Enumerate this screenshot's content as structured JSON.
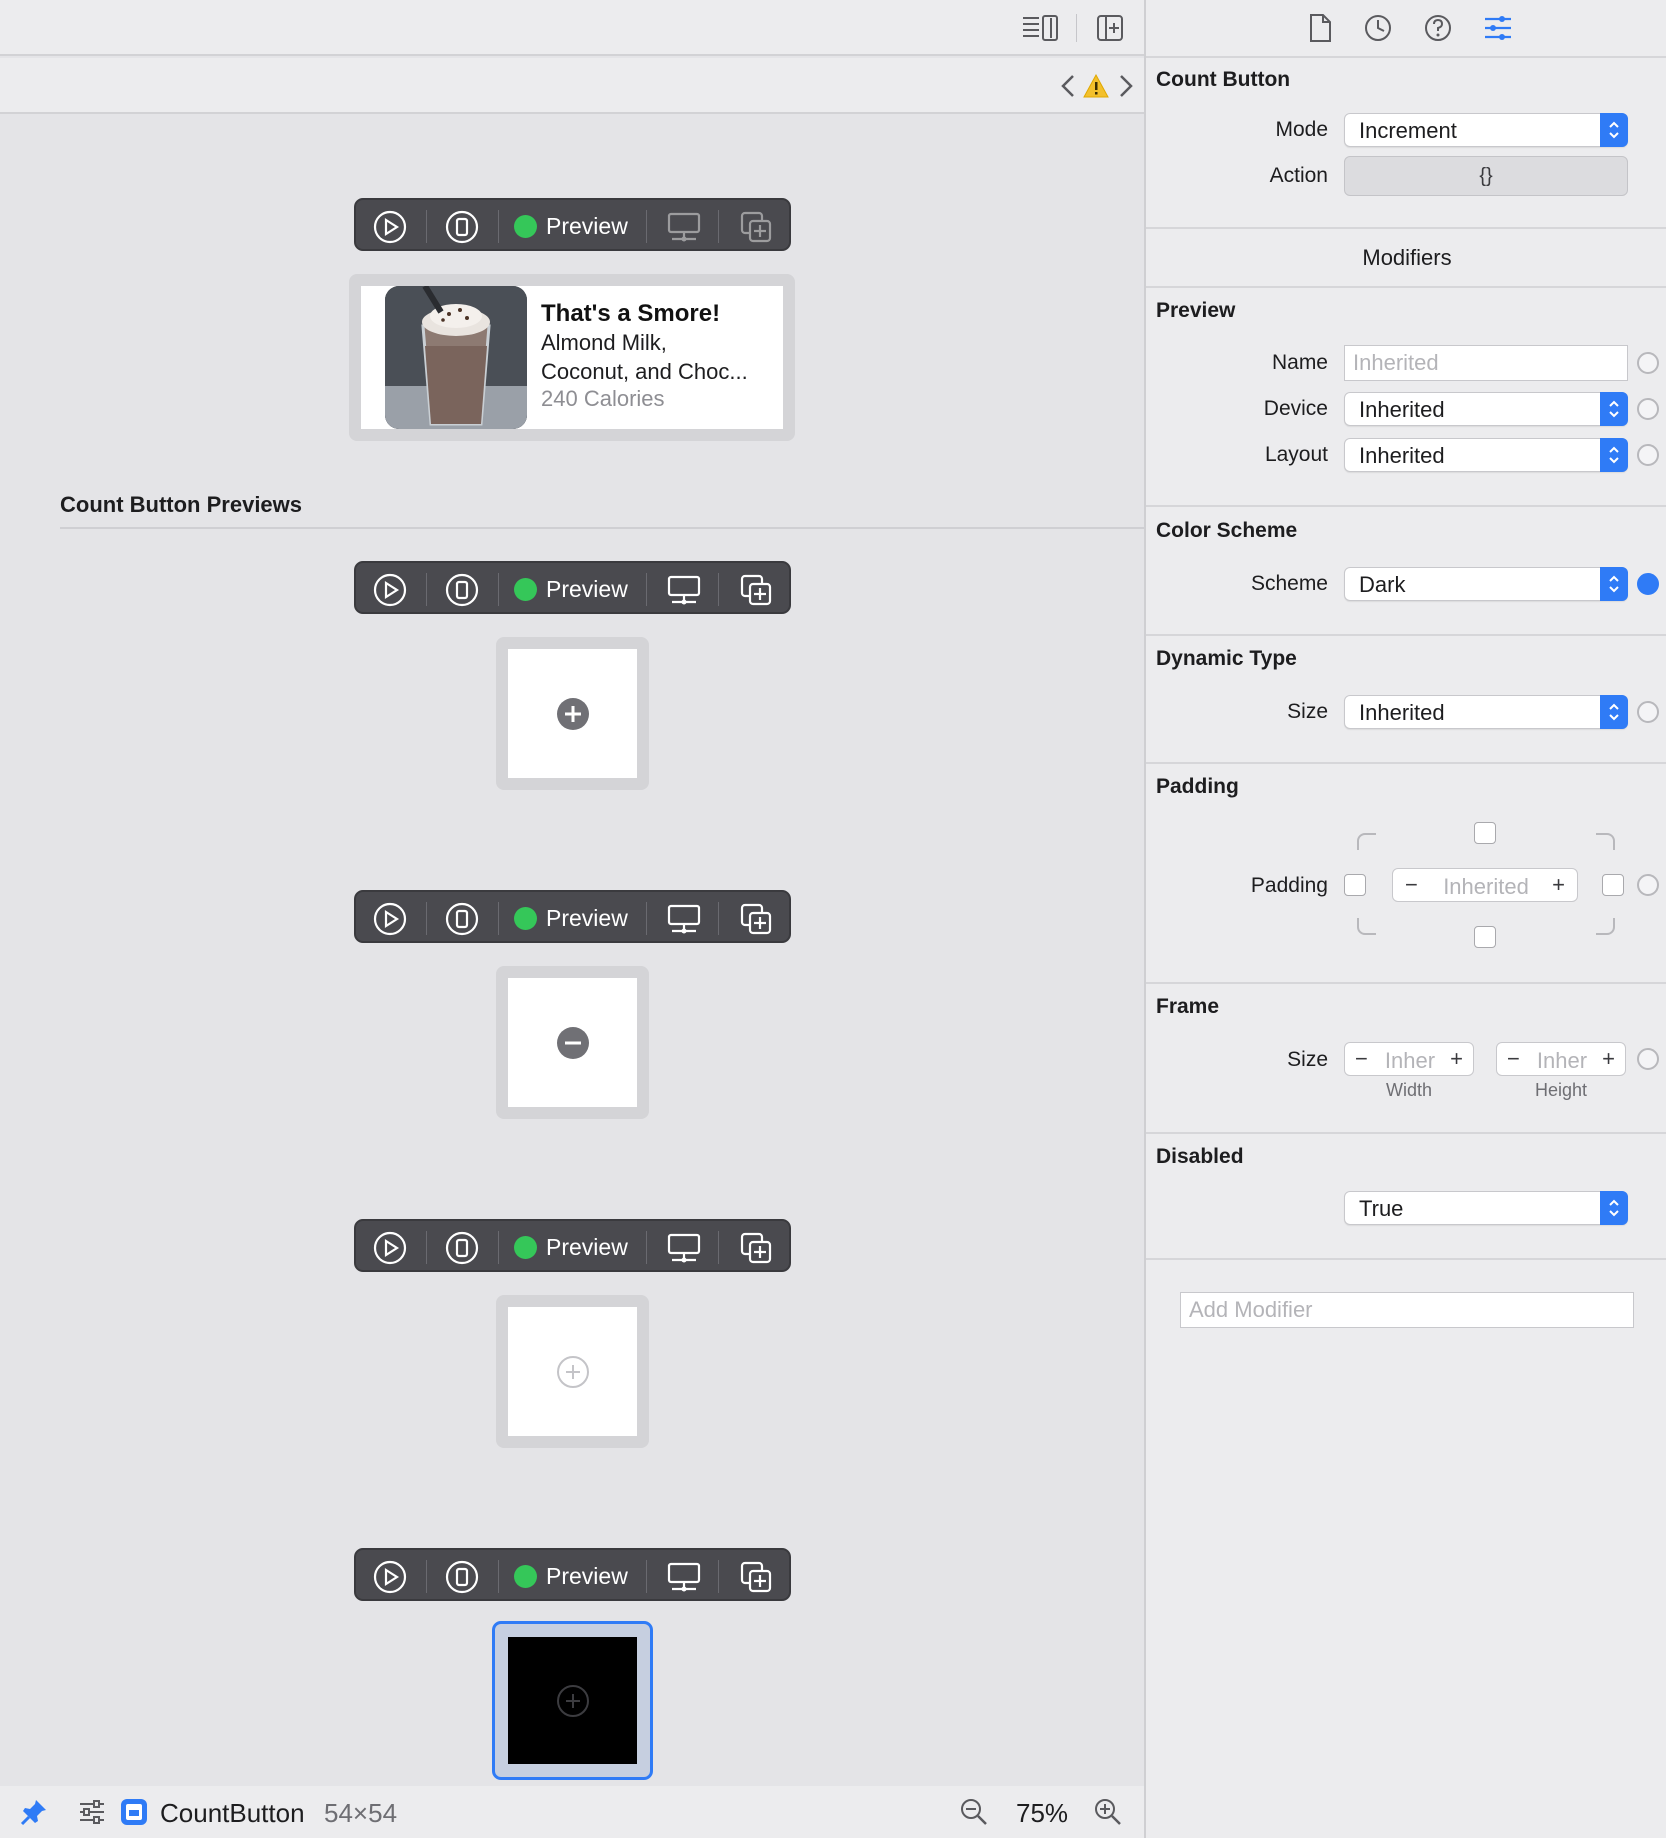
{
  "toolbar": {
    "icons": [
      "editor-options-icon",
      "add-editor-icon"
    ]
  },
  "nav": {
    "icons": [
      "chevron-left-icon",
      "warning-icon",
      "chevron-right-icon"
    ]
  },
  "canvas": {
    "preview_label": "Preview",
    "top_card": {
      "title": "That's a Smore!",
      "line1": "Almond Milk,",
      "line2": "Coconut, and Choc...",
      "calories": "240 Calories"
    },
    "section_title": "Count Button Previews",
    "previews": [
      {
        "glyph": "plus-filled"
      },
      {
        "glyph": "minus-filled"
      },
      {
        "glyph": "plus-outline"
      },
      {
        "glyph": "plus-outline-dark",
        "selected": true
      }
    ]
  },
  "bottom": {
    "component_name": "CountButton",
    "size": "54×54",
    "zoom": "75%"
  },
  "inspector": {
    "tabs": [
      "file-icon",
      "history-icon",
      "help-icon",
      "attributes-icon"
    ],
    "component_title": "Count Button",
    "mode_label": "Mode",
    "mode_value": "Increment",
    "action_label": "Action",
    "action_value": "{}",
    "modifiers_title": "Modifiers",
    "preview_section": "Preview",
    "name_label": "Name",
    "name_placeholder": "Inherited",
    "device_label": "Device",
    "device_value": "Inherited",
    "layout_label": "Layout",
    "layout_value": "Inherited",
    "color_scheme_section": "Color Scheme",
    "scheme_label": "Scheme",
    "scheme_value": "Dark",
    "dynamic_type_section": "Dynamic Type",
    "dt_size_label": "Size",
    "dt_size_value": "Inherited",
    "padding_section": "Padding",
    "padding_label": "Padding",
    "padding_value": "Inherited",
    "frame_section": "Frame",
    "frame_size_label": "Size",
    "frame_width_value": "Inher",
    "frame_height_value": "Inher",
    "width_label": "Width",
    "height_label": "Height",
    "disabled_section": "Disabled",
    "disabled_value": "True",
    "add_modifier_placeholder": "Add Modifier",
    "accent": "#2f7bf6"
  }
}
